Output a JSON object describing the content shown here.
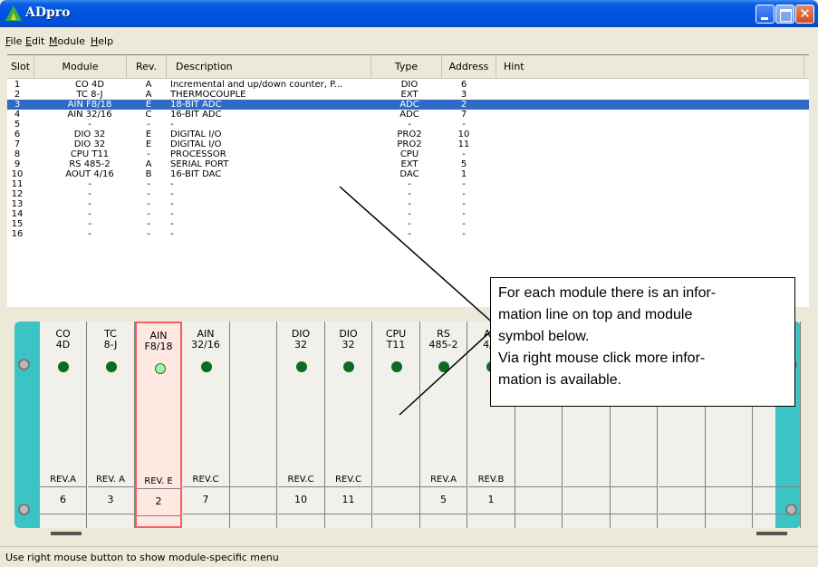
{
  "window": {
    "title": "ADpro"
  },
  "menu": [
    "File",
    "Edit",
    "Module",
    "Help"
  ],
  "columns": {
    "slot": "Slot",
    "module": "Module",
    "rev": "Rev.",
    "description": "Description",
    "type": "Type",
    "address": "Address",
    "hint": "Hint"
  },
  "rows": [
    {
      "slot": "1",
      "module": "CO 4D",
      "rev": "A",
      "desc": "Incremental and up/down counter, P...",
      "type": "DIO",
      "addr": "6"
    },
    {
      "slot": "2",
      "module": "TC 8-J",
      "rev": "A",
      "desc": "THERMOCOUPLE",
      "type": "EXT",
      "addr": "3"
    },
    {
      "slot": "3",
      "module": "AIN F8/18",
      "rev": "E",
      "desc": "18-BIT ADC",
      "type": "ADC",
      "addr": "2",
      "selected": true
    },
    {
      "slot": "4",
      "module": "AIN 32/16",
      "rev": "C",
      "desc": "16-BIT ADC",
      "type": "ADC",
      "addr": "7"
    },
    {
      "slot": "5",
      "module": "-",
      "rev": "-",
      "desc": "-",
      "type": "-",
      "addr": "-"
    },
    {
      "slot": "6",
      "module": "DIO 32",
      "rev": "E",
      "desc": "DIGITAL I/O",
      "type": "PRO2",
      "addr": "10"
    },
    {
      "slot": "7",
      "module": "DIO 32",
      "rev": "E",
      "desc": "DIGITAL I/O",
      "type": "PRO2",
      "addr": "11"
    },
    {
      "slot": "8",
      "module": "CPU T11",
      "rev": "-",
      "desc": "PROCESSOR",
      "type": "CPU",
      "addr": "-"
    },
    {
      "slot": "9",
      "module": "RS 485-2",
      "rev": "A",
      "desc": "SERIAL PORT",
      "type": "EXT",
      "addr": "5"
    },
    {
      "slot": "10",
      "module": "AOUT 4/16",
      "rev": "B",
      "desc": "16-BIT DAC",
      "type": "DAC",
      "addr": "1"
    },
    {
      "slot": "11",
      "module": "-",
      "rev": "-",
      "desc": "-",
      "type": "-",
      "addr": "-"
    },
    {
      "slot": "12",
      "module": "-",
      "rev": "-",
      "desc": "-",
      "type": "-",
      "addr": "-"
    },
    {
      "slot": "13",
      "module": "-",
      "rev": "-",
      "desc": "-",
      "type": "-",
      "addr": "-"
    },
    {
      "slot": "14",
      "module": "-",
      "rev": "-",
      "desc": "-",
      "type": "-",
      "addr": "-"
    },
    {
      "slot": "15",
      "module": "-",
      "rev": "-",
      "desc": "-",
      "type": "-",
      "addr": "-"
    },
    {
      "slot": "16",
      "module": "-",
      "rev": "-",
      "desc": "-",
      "type": "-",
      "addr": "-"
    }
  ],
  "rack_modules": [
    {
      "name": "CO\n4D",
      "rev": "REV.A",
      "addr": "6",
      "led": true
    },
    {
      "name": "TC\n8-J",
      "rev": "REV. A",
      "addr": "3",
      "led": true
    },
    {
      "name": "AIN\nF8/18",
      "rev": "REV. E",
      "addr": "2",
      "led": true,
      "led_light": true,
      "selected": true
    },
    {
      "name": "AIN\n32/16",
      "rev": "REV.C",
      "addr": "7",
      "led": true
    },
    {
      "name": "",
      "rev": "",
      "addr": "",
      "led": false
    },
    {
      "name": "DIO\n32",
      "rev": "REV.C",
      "addr": "10",
      "led": true
    },
    {
      "name": "DIO\n32",
      "rev": "REV.C",
      "addr": "11",
      "led": true
    },
    {
      "name": "CPU\nT11",
      "rev": "",
      "addr": "",
      "led": true
    },
    {
      "name": "RS\n485-2",
      "rev": "REV.A",
      "addr": "5",
      "led": true
    },
    {
      "name": "AO\n4/1",
      "rev": "REV.B",
      "addr": "1",
      "led": true
    },
    {
      "name": "",
      "rev": "",
      "addr": "",
      "led": false
    },
    {
      "name": "",
      "rev": "",
      "addr": "",
      "led": false
    },
    {
      "name": "",
      "rev": "",
      "addr": "",
      "led": false
    },
    {
      "name": "",
      "rev": "",
      "addr": "",
      "led": false
    },
    {
      "name": "",
      "rev": "",
      "addr": "",
      "led": false
    },
    {
      "name": "",
      "rev": "",
      "addr": "",
      "led": false
    }
  ],
  "callout": {
    "text": "For each module there is an infor-\nmation line on top and module\nsymbol below.\nVia right mouse click more infor-\nmation is available."
  },
  "status": {
    "text": "Use right mouse button to show module-specific menu"
  },
  "colors": {
    "title_bar": "#0054e3",
    "selection": "#316ac5",
    "rack": "#3cc4c4",
    "led": "#0b6b1f",
    "led_light": "#a8f0a8",
    "selected_module_border": "#ff5b5b"
  }
}
